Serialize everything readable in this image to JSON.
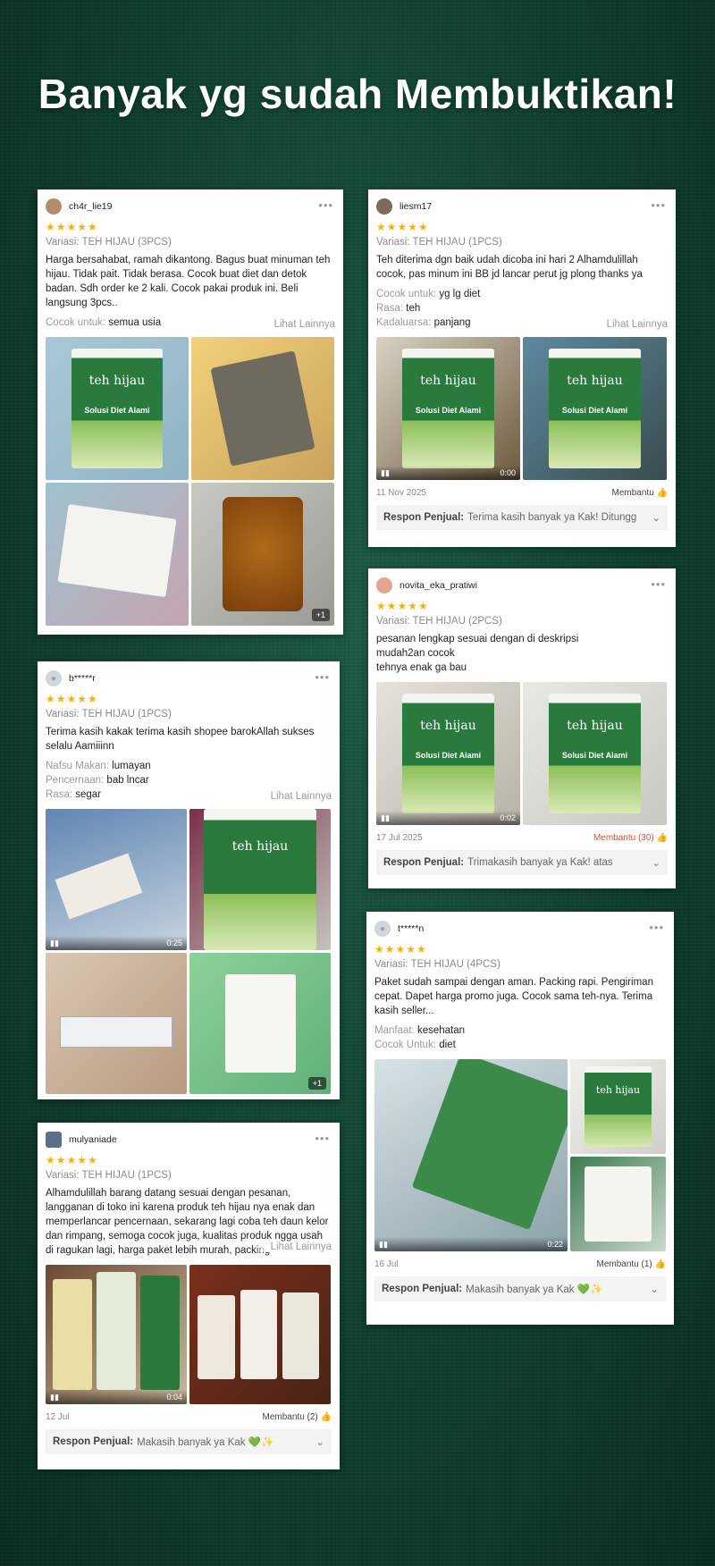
{
  "headline": "Banyak yg sudah Membuktikan!",
  "reviews": [
    {
      "username": "ch4r_lie19",
      "stars": "★★★★★",
      "variasi": "Variasi: TEH HIJAU (3PCS)",
      "text": "Harga bersahabat, ramah dikantong. Bagus buat minuman teh hijau. Tidak pait. Tidak berasa. Cocok buat diet dan detok badan. Sdh order ke 2 kali. Cocok pakai produk ini. Beli langsung 3pcs..",
      "attrs": [
        {
          "k": "Cocok untuk:",
          "v": "semua usia"
        }
      ],
      "lihat": "Lihat Lainnya",
      "more_badge": "+1"
    },
    {
      "username": "liesm17",
      "stars": "★★★★★",
      "variasi": "Variasi: TEH HIJAU (1PCS)",
      "text": "Teh diterima dgn baik udah dicoba ini hari 2 Alhamdulillah cocok, pas minum ini BB jd lancar  perut jg plong thanks ya",
      "attrs": [
        {
          "k": "Cocok untuk:",
          "v": "yg lg diet"
        },
        {
          "k": "Rasa:",
          "v": "teh"
        },
        {
          "k": "Kadaluarsa:",
          "v": "panjang"
        }
      ],
      "lihat": "Lihat Lainnya",
      "video_time": "0:00",
      "date": "11 Nov 2025",
      "helpful": "Membantu 👍",
      "respon_label": "Respon Penjual:",
      "respon_text": "Terima kasih banyak ya Kak! Ditungg"
    },
    {
      "username": "novita_eka_pratiwi",
      "stars": "★★★★★",
      "variasi": "Variasi: TEH HIJAU (2PCS)",
      "text": "pesanan lengkap sesuai dengan di deskripsi\nmudah2an cocok\ntehnya enak ga bau",
      "video_time": "0:02",
      "date": "17 Jul 2025",
      "helpful": "Membantu (30) 👍",
      "respon_label": "Respon Penjual:",
      "respon_text": "Trimakasih banyak ya Kak! atas"
    },
    {
      "username": "b*****r",
      "stars": "★★★★★",
      "variasi": "Variasi: TEH HIJAU (1PCS)",
      "text": "Terima kasih kakak terima kasih shopee barokAllah sukses selalu Aamiiinn",
      "attrs": [
        {
          "k": "Nafsu Makan:",
          "v": "lumayan"
        },
        {
          "k": "Pencernaan:",
          "v": "bab lncar"
        },
        {
          "k": "Rasa:",
          "v": "segar"
        }
      ],
      "lihat": "Lihat Lainnya",
      "video_time": "0:25",
      "more_badge": "+1"
    },
    {
      "username": "t*****n",
      "stars": "★★★★★",
      "variasi": "Variasi: TEH HIJAU (4PCS)",
      "text": "Paket sudah sampai dengan aman. Packing rapi. Pengiriman cepat. Dapet harga promo juga. Cocok sama teh-nya. Terima kasih seller...",
      "attrs": [
        {
          "k": "Manfaat:",
          "v": "kesehatan"
        },
        {
          "k": "Cocok Untuk:",
          "v": "diet"
        }
      ],
      "video_time": "0:22",
      "date": "16 Jul",
      "helpful": "Membantu (1) 👍",
      "respon_label": "Respon Penjual:",
      "respon_text": "Makasih banyak ya Kak 💚✨"
    },
    {
      "username": "mulyaniade",
      "stars": "★★★★★",
      "variasi": "Variasi: TEH HIJAU (1PCS)",
      "text": "Alhamdulillah barang datang sesuai dengan pesanan, langganan di toko ini karena produk teh hijau nya enak dan memperlancar pencernaan, sekarang lagi coba teh daun kelor dan rimpang, semoga cocok juga, kualitas produk ngga usah di ragukan lagi, harga paket lebih murah, packing",
      "lihat": "Lihat Lainnya",
      "video_time": "0:04",
      "date": "12 Jul",
      "helpful": "Membantu (2) 👍",
      "respon_label": "Respon Penjual:",
      "respon_text": "Makasih banyak ya Kak 💚✨"
    }
  ],
  "pack": {
    "brand": "teh hijau",
    "tagline": "Solusi Diet Alami"
  },
  "colors": {
    "bg": "#0d3a2c",
    "pack_green": "#2a7a3d",
    "star": "#f5b301",
    "hot": "#e0482e"
  }
}
